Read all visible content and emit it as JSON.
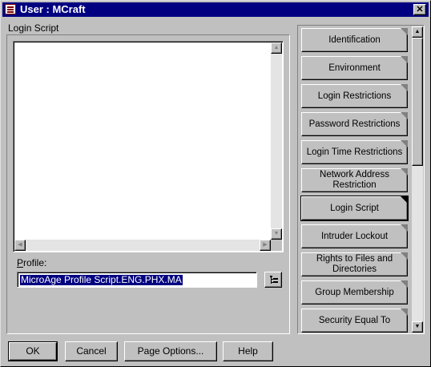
{
  "window": {
    "title": "User : MCraft",
    "close_glyph": "✕"
  },
  "login_script": {
    "group_label": "Login Script",
    "script_text": ""
  },
  "profile": {
    "label_accesskey": "P",
    "label_rest": "rofile:",
    "value": "MicroAge Profile Script.ENG.PHX.MA",
    "browse_icon": "browse-tree-icon"
  },
  "pages": {
    "items": [
      "Identification",
      "Environment",
      "Login Restrictions",
      "Password Restrictions",
      "Login Time Restrictions",
      "Network Address Restriction",
      "Login Script",
      "Intruder Lockout",
      "Rights to Files and Directories",
      "Group Membership",
      "Security Equal To"
    ],
    "active": "Login Script"
  },
  "buttons": {
    "ok": "OK",
    "cancel": "Cancel",
    "page_options": "Page Options...",
    "help": "Help"
  },
  "colors": {
    "titlebar": "#000080",
    "face": "#c0c0c0",
    "selection": "#000080"
  }
}
